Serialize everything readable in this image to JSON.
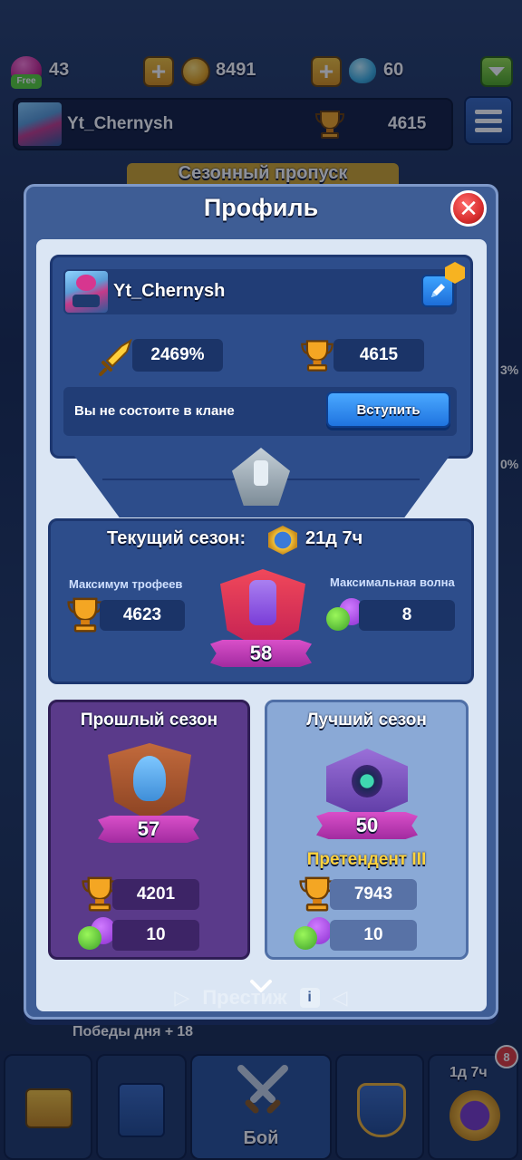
{
  "topbar": {
    "energy_value": "43",
    "energy_badge": "Free",
    "coins_value": "8491",
    "gems_value": "60",
    "player_name": "Yt_Chernysh",
    "player_trophies": "4615"
  },
  "background": {
    "season_pass_label": "Сезонный пропуск",
    "daily_wins_label": "Победы дня +",
    "daily_wins_value": "18",
    "side_percent_1": "3%",
    "side_percent_2": "0%"
  },
  "modal": {
    "title": "Профиль",
    "close_icon": "close-icon"
  },
  "profile": {
    "name": "Yt_Chernysh",
    "power_value": "2469%",
    "trophies_value": "4615",
    "clan_status": "Вы не состоите в клане",
    "join_label": "Вступить"
  },
  "current_season": {
    "title": "Текущий сезон:",
    "time_left": "21д 7ч",
    "max_trophies_label": "Максимум трофеев",
    "max_trophies_value": "4623",
    "max_wave_label": "Максимальная волна",
    "max_wave_value": "8",
    "season_level": "58"
  },
  "last_season": {
    "title": "Прошлый сезон",
    "level": "57",
    "trophies": "4201",
    "wave": "10"
  },
  "best_season": {
    "title": "Лучший сезон",
    "level": "50",
    "rank": "Претендент III",
    "trophies": "7943",
    "wave": "10"
  },
  "footer": {
    "prestige_label": "Престиж"
  },
  "nav": {
    "battle_label": "Бой",
    "timer_label": "1д 7ч",
    "timer_badge": "8"
  },
  "colors": {
    "modal_bg": "#3e5d95",
    "card_blue": "#2d4d8b",
    "last_season_purple": "#5a3a8a",
    "best_season_blue": "#8aa9d6",
    "rank_gold": "#ffd33d",
    "join_blue": "#1f74e0",
    "close_red": "#d92f2f"
  }
}
